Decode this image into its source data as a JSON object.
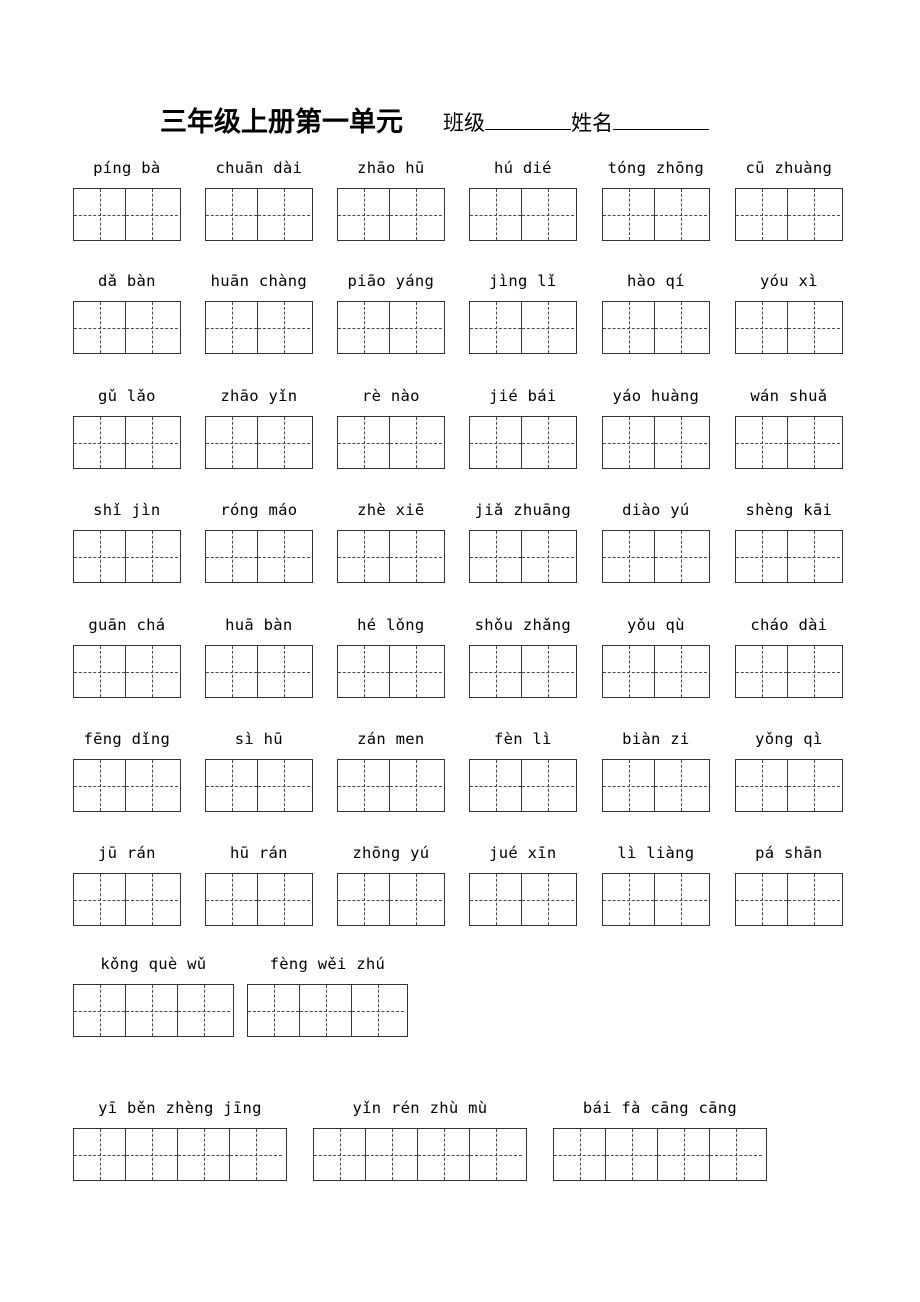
{
  "document": {
    "title": "三年级上册第一单元",
    "meta": {
      "class_label": "班级",
      "name_label": "姓名"
    }
  },
  "worksheet": {
    "rows": [
      {
        "cells_per_word": 2,
        "words": [
          {
            "pinyin": "píng bà",
            "cells": 2
          },
          {
            "pinyin": "chuān dài",
            "cells": 2
          },
          {
            "pinyin": "zhāo hū",
            "cells": 2
          },
          {
            "pinyin": "hú dié",
            "cells": 2
          },
          {
            "pinyin": "tóng zhōng",
            "cells": 2
          },
          {
            "pinyin": "cū zhuàng",
            "cells": 2
          }
        ]
      },
      {
        "cells_per_word": 2,
        "words": [
          {
            "pinyin": "dǎ bàn",
            "cells": 2
          },
          {
            "pinyin": "huān chàng",
            "cells": 2
          },
          {
            "pinyin": "piāo yáng",
            "cells": 2
          },
          {
            "pinyin": "jìng lǐ",
            "cells": 2
          },
          {
            "pinyin": "hào qí",
            "cells": 2
          },
          {
            "pinyin": "yóu xì",
            "cells": 2
          }
        ]
      },
      {
        "cells_per_word": 2,
        "words": [
          {
            "pinyin": "gǔ lǎo",
            "cells": 2
          },
          {
            "pinyin": "zhāo yǐn",
            "cells": 2
          },
          {
            "pinyin": "rè nào",
            "cells": 2
          },
          {
            "pinyin": "jié bái",
            "cells": 2
          },
          {
            "pinyin": "yáo huàng",
            "cells": 2
          },
          {
            "pinyin": "wán shuǎ",
            "cells": 2
          }
        ]
      },
      {
        "cells_per_word": 2,
        "words": [
          {
            "pinyin": "shǐ jìn",
            "cells": 2
          },
          {
            "pinyin": "róng máo",
            "cells": 2
          },
          {
            "pinyin": "zhè xiē",
            "cells": 2
          },
          {
            "pinyin": "jiǎ zhuāng",
            "cells": 2
          },
          {
            "pinyin": "diào yú",
            "cells": 2
          },
          {
            "pinyin": "shèng kāi",
            "cells": 2
          }
        ]
      },
      {
        "cells_per_word": 2,
        "words": [
          {
            "pinyin": "guān chá",
            "cells": 2
          },
          {
            "pinyin": "huā bàn",
            "cells": 2
          },
          {
            "pinyin": "hé lǒng",
            "cells": 2
          },
          {
            "pinyin": "shǒu zhǎng",
            "cells": 2
          },
          {
            "pinyin": "yǒu qù",
            "cells": 2
          },
          {
            "pinyin": "cháo dài",
            "cells": 2
          }
        ]
      },
      {
        "cells_per_word": 2,
        "words": [
          {
            "pinyin": "fēng dǐng",
            "cells": 2
          },
          {
            "pinyin": "sì hū",
            "cells": 2
          },
          {
            "pinyin": "zán men",
            "cells": 2
          },
          {
            "pinyin": "fèn lì",
            "cells": 2
          },
          {
            "pinyin": "biàn zi",
            "cells": 2
          },
          {
            "pinyin": "yǒng qì",
            "cells": 2
          }
        ]
      },
      {
        "cells_per_word": 2,
        "words": [
          {
            "pinyin": "jū rán",
            "cells": 2
          },
          {
            "pinyin": "hū rán",
            "cells": 2
          },
          {
            "pinyin": "zhōng yú",
            "cells": 2
          },
          {
            "pinyin": "jué xīn",
            "cells": 2
          },
          {
            "pinyin": "lì liàng",
            "cells": 2
          },
          {
            "pinyin": "pá shān",
            "cells": 2
          }
        ]
      },
      {
        "cells_per_word": 3,
        "words": [
          {
            "pinyin": "kǒng què wǔ",
            "cells": 3
          },
          {
            "pinyin": "fèng wěi zhú",
            "cells": 3
          }
        ]
      },
      {
        "cells_per_word": 4,
        "words": [
          {
            "pinyin": "yī běn zhèng jīng",
            "cells": 4
          },
          {
            "pinyin": "yǐn rén zhù mù",
            "cells": 4
          },
          {
            "pinyin": "bái fà cāng cāng",
            "cells": 4
          }
        ]
      }
    ]
  },
  "layout": {
    "row_tops": [
      158,
      271,
      386,
      500,
      615,
      729,
      843,
      954,
      1098
    ],
    "col_lefts_6": [
      73,
      205,
      337,
      469,
      602,
      735
    ],
    "col_lefts_3": [
      73,
      247
    ],
    "col_lefts_4": [
      73,
      313,
      553
    ]
  },
  "colors": {
    "ink": "#000000",
    "grid_border": "#333333",
    "grid_dash": "#4a4a4a",
    "paper": "#ffffff"
  }
}
